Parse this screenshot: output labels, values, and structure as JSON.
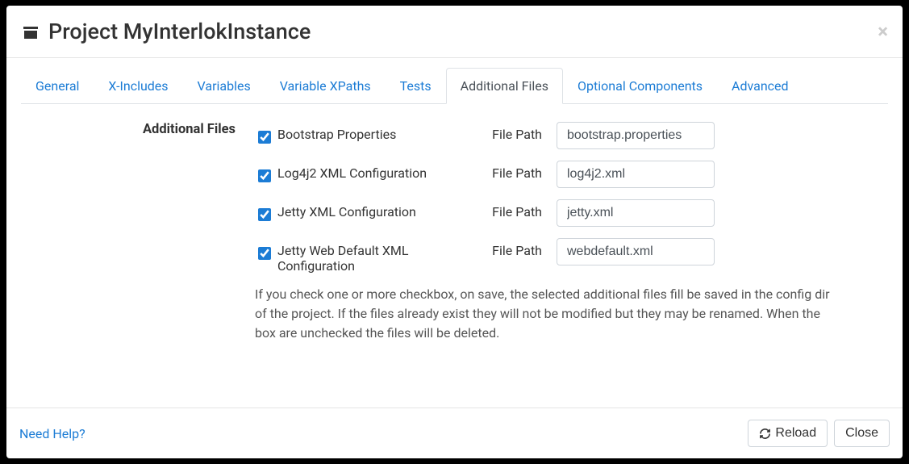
{
  "header": {
    "title_prefix": "Project",
    "title_name": "MyInterlokInstance"
  },
  "tabs": {
    "items": [
      {
        "label": "General"
      },
      {
        "label": "X-Includes"
      },
      {
        "label": "Variables"
      },
      {
        "label": "Variable XPaths"
      },
      {
        "label": "Tests"
      },
      {
        "label": "Additional Files"
      },
      {
        "label": "Optional Components"
      },
      {
        "label": "Advanced"
      }
    ],
    "active": "Additional Files"
  },
  "section": {
    "label": "Additional Files",
    "file_path_label": "File Path",
    "rows": [
      {
        "checked": true,
        "label": "Bootstrap Properties",
        "value": "bootstrap.properties"
      },
      {
        "checked": true,
        "label": "Log4j2 XML Configuration",
        "value": "log4j2.xml"
      },
      {
        "checked": true,
        "label": "Jetty XML Configuration",
        "value": "jetty.xml"
      },
      {
        "checked": true,
        "label": "Jetty Web Default XML Configuration",
        "value": "webdefault.xml"
      }
    ],
    "help_text": "If you check one or more checkbox, on save, the selected additional files fill be saved in the config dir of the project. If the files already exist they will not be modified but they may be renamed. When the box are unchecked the files will be deleted."
  },
  "footer": {
    "help_link": "Need Help?",
    "reload_button": "Reload",
    "close_button": "Close"
  }
}
